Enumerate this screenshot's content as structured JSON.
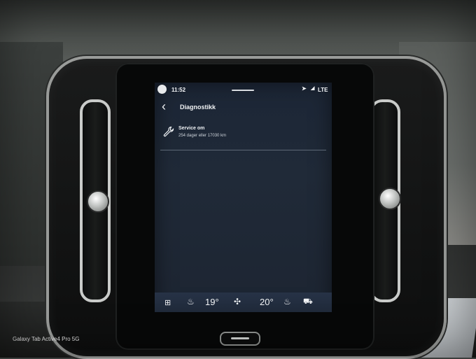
{
  "status_bar": {
    "time": "11:52",
    "network": "LTE",
    "icons": [
      "profile-icon",
      "navigation-icon",
      "signal-icon"
    ]
  },
  "header": {
    "back_icon": "chevron-left-icon",
    "title": "Diagnostikk"
  },
  "service": {
    "icon": "wrench-icon",
    "label": "Service om",
    "detail": "254 dager eller 17030 km"
  },
  "climate_bar": {
    "left_temp": "19°",
    "right_temp": "20°",
    "icons": [
      "grid-icon",
      "seat-heat-left-icon",
      "fan-icon",
      "seat-heat-right-icon",
      "car-icon"
    ]
  },
  "watermark": "Galaxy Tab Active4 Pro 5G"
}
